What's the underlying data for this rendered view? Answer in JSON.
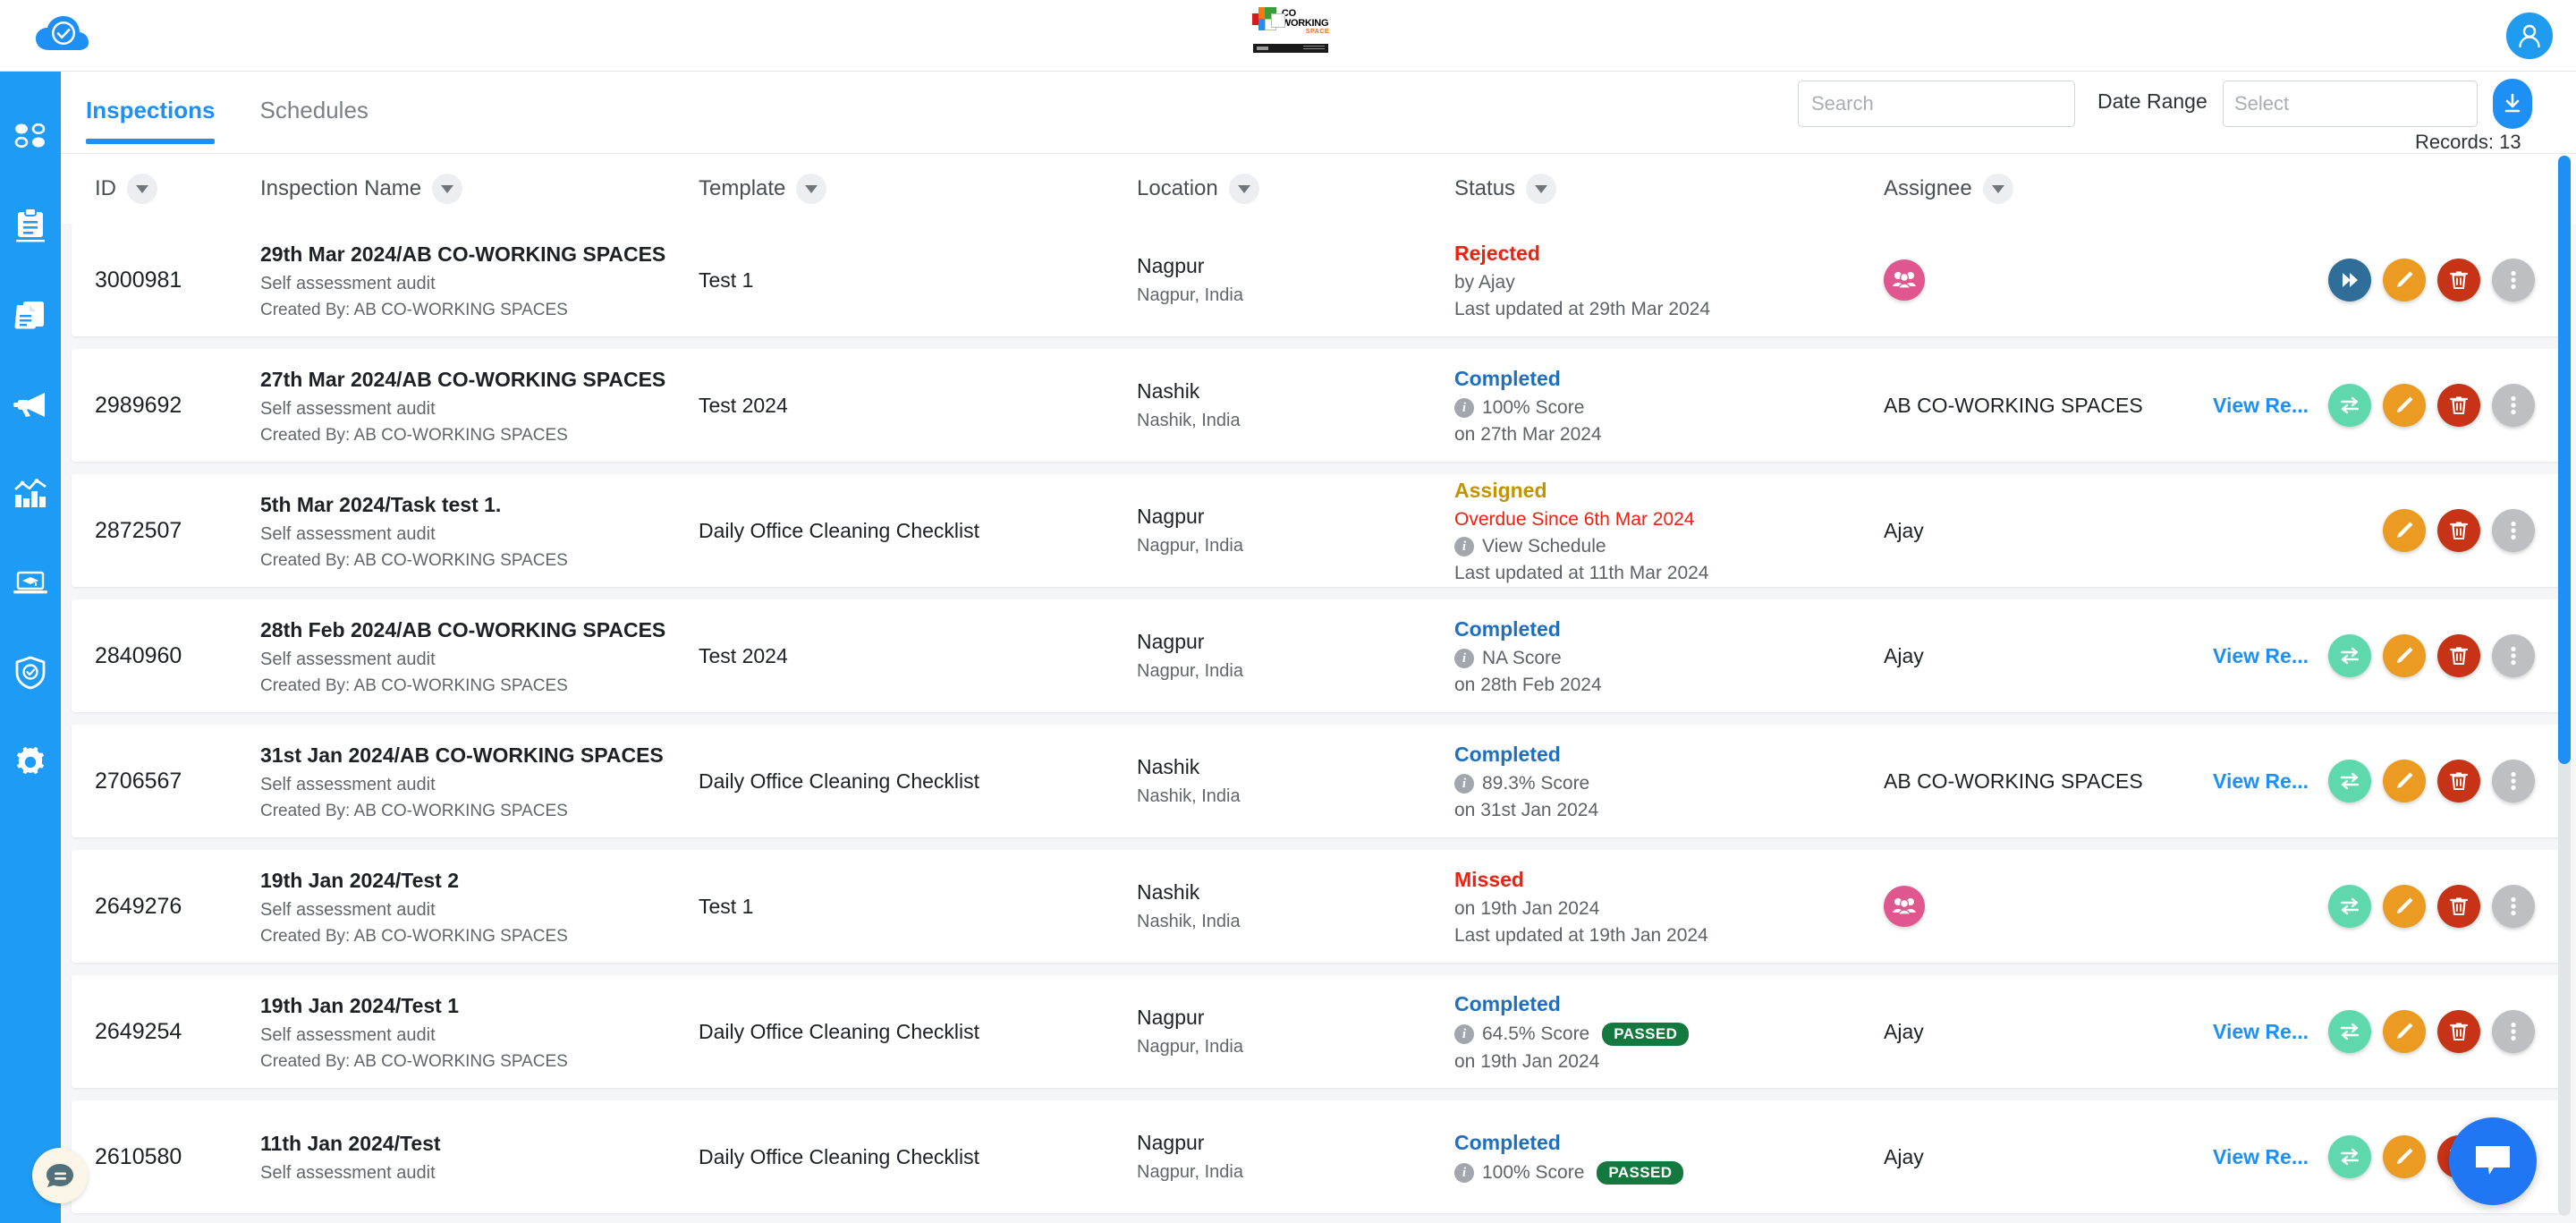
{
  "app": {
    "brand_icon": "cloud-check-icon",
    "center_logo": {
      "word_top": "CO WORKING",
      "word_bottom": "SPACE"
    },
    "user_avatar_icon": "user-avatar-icon"
  },
  "sidebar": {
    "items": [
      {
        "icon": "dashboard-dots-icon",
        "name": "dashboard"
      },
      {
        "icon": "clipboard-icon",
        "name": "inspections"
      },
      {
        "icon": "documents-icon",
        "name": "templates"
      },
      {
        "icon": "megaphone-icon",
        "name": "announcements"
      },
      {
        "icon": "bar-chart-icon",
        "name": "reports"
      },
      {
        "icon": "training-laptop-icon",
        "name": "training"
      },
      {
        "icon": "shield-check-icon",
        "name": "compliance"
      },
      {
        "icon": "gear-icon",
        "name": "settings"
      }
    ]
  },
  "tabs": [
    {
      "label": "Inspections",
      "active": true
    },
    {
      "label": "Schedules",
      "active": false
    }
  ],
  "filters": {
    "search_placeholder": "Search",
    "search_value": "",
    "date_range_label": "Date Range",
    "date_placeholder": "Select",
    "date_value": "",
    "clear_icon": "close-x-icon",
    "download_icon": "download-icon",
    "records_text": "Records: 13"
  },
  "table": {
    "columns": [
      {
        "label": "ID"
      },
      {
        "label": "Inspection Name"
      },
      {
        "label": "Template"
      },
      {
        "label": "Location"
      },
      {
        "label": "Status"
      },
      {
        "label": "Assignee"
      }
    ],
    "rows": [
      {
        "id": "3000981",
        "name": "29th Mar 2024/AB CO-WORKING SPACES",
        "subtitle": "Self assessment audit",
        "created_by": "Created By: AB CO-WORKING SPACES",
        "template": "Test 1",
        "location": "Nagpur",
        "location_sub": "Nagpur, India",
        "status": "Rejected",
        "status_type": "rejected",
        "status_line1": "by Ajay",
        "status_line1_icon": false,
        "status_line2": "Last updated at 29th Mar 2024",
        "badge": "",
        "assignee": "",
        "assignee_group": true,
        "view_link": "",
        "actions": [
          "forward",
          "edit",
          "delete",
          "more"
        ]
      },
      {
        "id": "2989692",
        "name": "27th Mar 2024/AB CO-WORKING SPACES",
        "subtitle": "Self assessment audit",
        "created_by": "Created By: AB CO-WORKING SPACES",
        "template": "Test 2024",
        "location": "Nashik",
        "location_sub": "Nashik, India",
        "status": "Completed",
        "status_type": "completed",
        "status_line1": "100%  Score",
        "status_line1_icon": true,
        "status_line2": "on 27th Mar 2024",
        "badge": "",
        "assignee": "AB CO-WORKING SPACES",
        "assignee_group": false,
        "view_link": "View Re...",
        "actions": [
          "swap",
          "edit",
          "delete",
          "more"
        ]
      },
      {
        "id": "2872507",
        "name": "5th Mar 2024/Task test 1.",
        "subtitle": "Self assessment audit",
        "created_by": "Created By: AB CO-WORKING SPACES",
        "template": "Daily Office Cleaning Checklist",
        "location": "Nagpur",
        "location_sub": "Nagpur, India",
        "status": "Assigned",
        "status_type": "assigned",
        "overdue": "Overdue Since 6th Mar 2024",
        "status_line1": "View Schedule",
        "status_line1_icon": true,
        "status_line2": "Last updated at 11th Mar 2024",
        "badge": "",
        "assignee": "Ajay",
        "assignee_group": false,
        "view_link": "",
        "actions": [
          "edit",
          "delete",
          "more"
        ]
      },
      {
        "id": "2840960",
        "name": "28th Feb 2024/AB CO-WORKING SPACES",
        "subtitle": "Self assessment audit",
        "created_by": "Created By: AB CO-WORKING SPACES",
        "template": "Test 2024",
        "location": "Nagpur",
        "location_sub": "Nagpur, India",
        "status": "Completed",
        "status_type": "completed",
        "status_line1": "NA  Score",
        "status_line1_icon": true,
        "status_line2": "on 28th Feb 2024",
        "badge": "",
        "assignee": "Ajay",
        "assignee_group": false,
        "view_link": "View Re...",
        "actions": [
          "swap",
          "edit",
          "delete",
          "more"
        ]
      },
      {
        "id": "2706567",
        "name": "31st Jan 2024/AB CO-WORKING SPACES",
        "subtitle": "Self assessment audit",
        "created_by": "Created By: AB CO-WORKING SPACES",
        "template": "Daily Office Cleaning Checklist",
        "location": "Nashik",
        "location_sub": "Nashik, India",
        "status": "Completed",
        "status_type": "completed",
        "status_line1": "89.3%  Score",
        "status_line1_icon": true,
        "status_line2": "on 31st Jan 2024",
        "badge": "",
        "assignee": "AB CO-WORKING SPACES",
        "assignee_group": false,
        "view_link": "View Re...",
        "actions": [
          "swap",
          "edit",
          "delete",
          "more"
        ]
      },
      {
        "id": "2649276",
        "name": "19th Jan 2024/Test 2",
        "subtitle": "Self assessment audit",
        "created_by": "Created By: AB CO-WORKING SPACES",
        "template": "Test 1",
        "location": "Nashik",
        "location_sub": "Nashik, India",
        "status": "Missed",
        "status_type": "missed",
        "status_line1": "on 19th Jan 2024",
        "status_line1_icon": false,
        "status_line2": "Last updated at 19th Jan 2024",
        "badge": "",
        "assignee": "",
        "assignee_group": true,
        "view_link": "",
        "actions": [
          "swap",
          "edit",
          "delete",
          "more"
        ]
      },
      {
        "id": "2649254",
        "name": "19th Jan 2024/Test 1",
        "subtitle": "Self assessment audit",
        "created_by": "Created By: AB CO-WORKING SPACES",
        "template": "Daily Office Cleaning Checklist",
        "location": "Nagpur",
        "location_sub": "Nagpur, India",
        "status": "Completed",
        "status_type": "completed",
        "status_line1": "64.5% Score",
        "status_line1_icon": true,
        "status_line2": "on 19th Jan 2024",
        "badge": "PASSED",
        "assignee": "Ajay",
        "assignee_group": false,
        "view_link": "View Re...",
        "actions": [
          "swap",
          "edit",
          "delete",
          "more"
        ]
      },
      {
        "id": "2610580",
        "name": "11th Jan 2024/Test",
        "subtitle": "Self assessment audit",
        "created_by": "",
        "template": "Daily Office Cleaning Checklist",
        "location": "Nagpur",
        "location_sub": "Nagpur, India",
        "status": "Completed",
        "status_type": "completed",
        "status_line1": "100% Score",
        "status_line1_icon": true,
        "status_line2": "",
        "badge": "PASSED",
        "assignee": "Ajay",
        "assignee_group": false,
        "view_link": "View Re...",
        "actions": [
          "swap",
          "edit",
          "delete",
          "more"
        ]
      }
    ]
  },
  "floating": {
    "left_chat_icon": "chat-bubble-icon",
    "right_chat_icon": "message-bubble-icon"
  },
  "colors": {
    "brand_blue": "#1e90f5",
    "sidebar_blue": "#1e9bf5",
    "rejected_red": "#ef2010",
    "completed_blue": "#1e6fc0",
    "assigned_yellow": "#c29400",
    "passed_green": "#13793f",
    "edit_orange": "#eb9a22",
    "delete_red": "#c73317",
    "swap_green": "#5fd8ae",
    "forward_blue": "#2e6e98",
    "more_gray": "#bdbfc2",
    "group_pink": "#e0568f"
  }
}
